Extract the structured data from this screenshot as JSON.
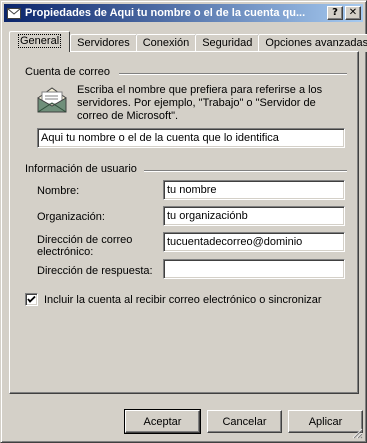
{
  "window": {
    "title": "Propiedades de Aqui tu nombre o el de la cuenta qu...",
    "help_button": "?",
    "close_button": "✕"
  },
  "tabs": [
    {
      "label": "General",
      "active": true
    },
    {
      "label": "Servidores"
    },
    {
      "label": "Conexión"
    },
    {
      "label": "Seguridad"
    },
    {
      "label": "Opciones avanzadas"
    }
  ],
  "mail_account": {
    "group_label": "Cuenta de correo",
    "description": "Escriba el nombre que prefiera para referirse a los servidores. Por ejemplo, \"Trabajo\" o \"Servidor de correo de Microsoft\".",
    "account_name_value": "Aqui tu nombre o el de la cuenta que lo identifica"
  },
  "user_info": {
    "group_label": "Información de usuario",
    "name_label": "Nombre:",
    "name_value": "tu nombre",
    "org_label": "Organización:",
    "org_value": "tu organizaciónb",
    "email_label_1": "Dirección de correo",
    "email_label_2": "electrónico:",
    "email_value": "tucuentadecorreo@dominio",
    "reply_label": "Dirección de respuesta:",
    "reply_value": ""
  },
  "include_checkbox": {
    "label": "Incluir la cuenta al recibir correo electrónico o sincronizar",
    "checked": true
  },
  "buttons": {
    "ok": "Aceptar",
    "cancel": "Cancelar",
    "apply": "Aplicar"
  },
  "icons": {
    "title_icon": "envelope-icon",
    "account_icon": "open-envelope-icon"
  }
}
